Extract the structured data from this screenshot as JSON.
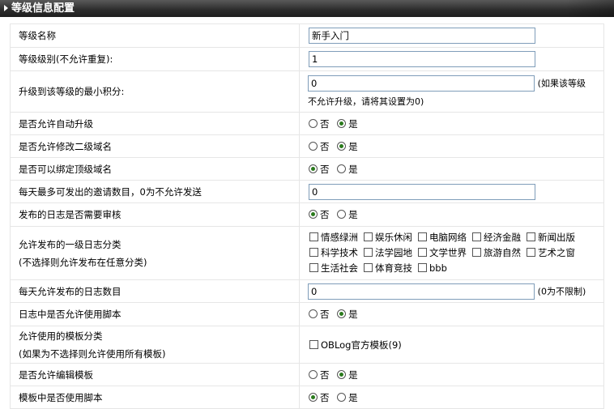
{
  "header": {
    "title": "等级信息配置"
  },
  "rows": {
    "level_name": {
      "label": "等级名称",
      "value": "新手入门"
    },
    "level_grade": {
      "label": "等级级别(不允许重复):",
      "value": "1"
    },
    "min_points": {
      "label": "升级到该等级的最小积分:",
      "value": "0",
      "hint_right": "(如果该等级",
      "hint_below": "不允许升级，请将其设置为0)"
    },
    "auto_upgrade": {
      "label": "是否允许自动升级",
      "selected": "是"
    },
    "modify_subdomain": {
      "label": "是否允许修改二级域名",
      "selected": "是"
    },
    "bind_domain": {
      "label": "是否可以绑定顶级域名",
      "selected": "否"
    },
    "daily_invites": {
      "label": "每天最多可发出的邀请数目，0为不允许发送",
      "value": "0"
    },
    "log_review": {
      "label": "发布的日志是否需要审核",
      "selected": "否"
    },
    "log_categories": {
      "label_line1": "允许发布的一级日志分类",
      "label_line2": "(不选择则允许发布在任意分类)",
      "categories": [
        "情感绿洲",
        "娱乐休闲",
        "电脑网络",
        "经济金融",
        "新闻出版",
        "科学技术",
        "法学园地",
        "文学世界",
        "旅游自然",
        "艺术之窗",
        "生活社会",
        "体育竞技",
        "bbb"
      ]
    },
    "daily_logs": {
      "label": "每天允许发布的日志数目",
      "value": "0",
      "hint": "(0为不限制)"
    },
    "log_script": {
      "label": "日志中是否允许使用脚本",
      "selected": "是"
    },
    "templates": {
      "label_line1": "允许使用的模板分类",
      "label_line2": "(如果为不选择则允许使用所有模板)",
      "option": "OBLog官方模板(9)"
    },
    "edit_template": {
      "label": "是否允许编辑模板",
      "selected": "是"
    },
    "template_script": {
      "label": "模板中是否使用脚本",
      "selected": "否"
    }
  },
  "radio_labels": {
    "no": "否",
    "yes": "是"
  }
}
